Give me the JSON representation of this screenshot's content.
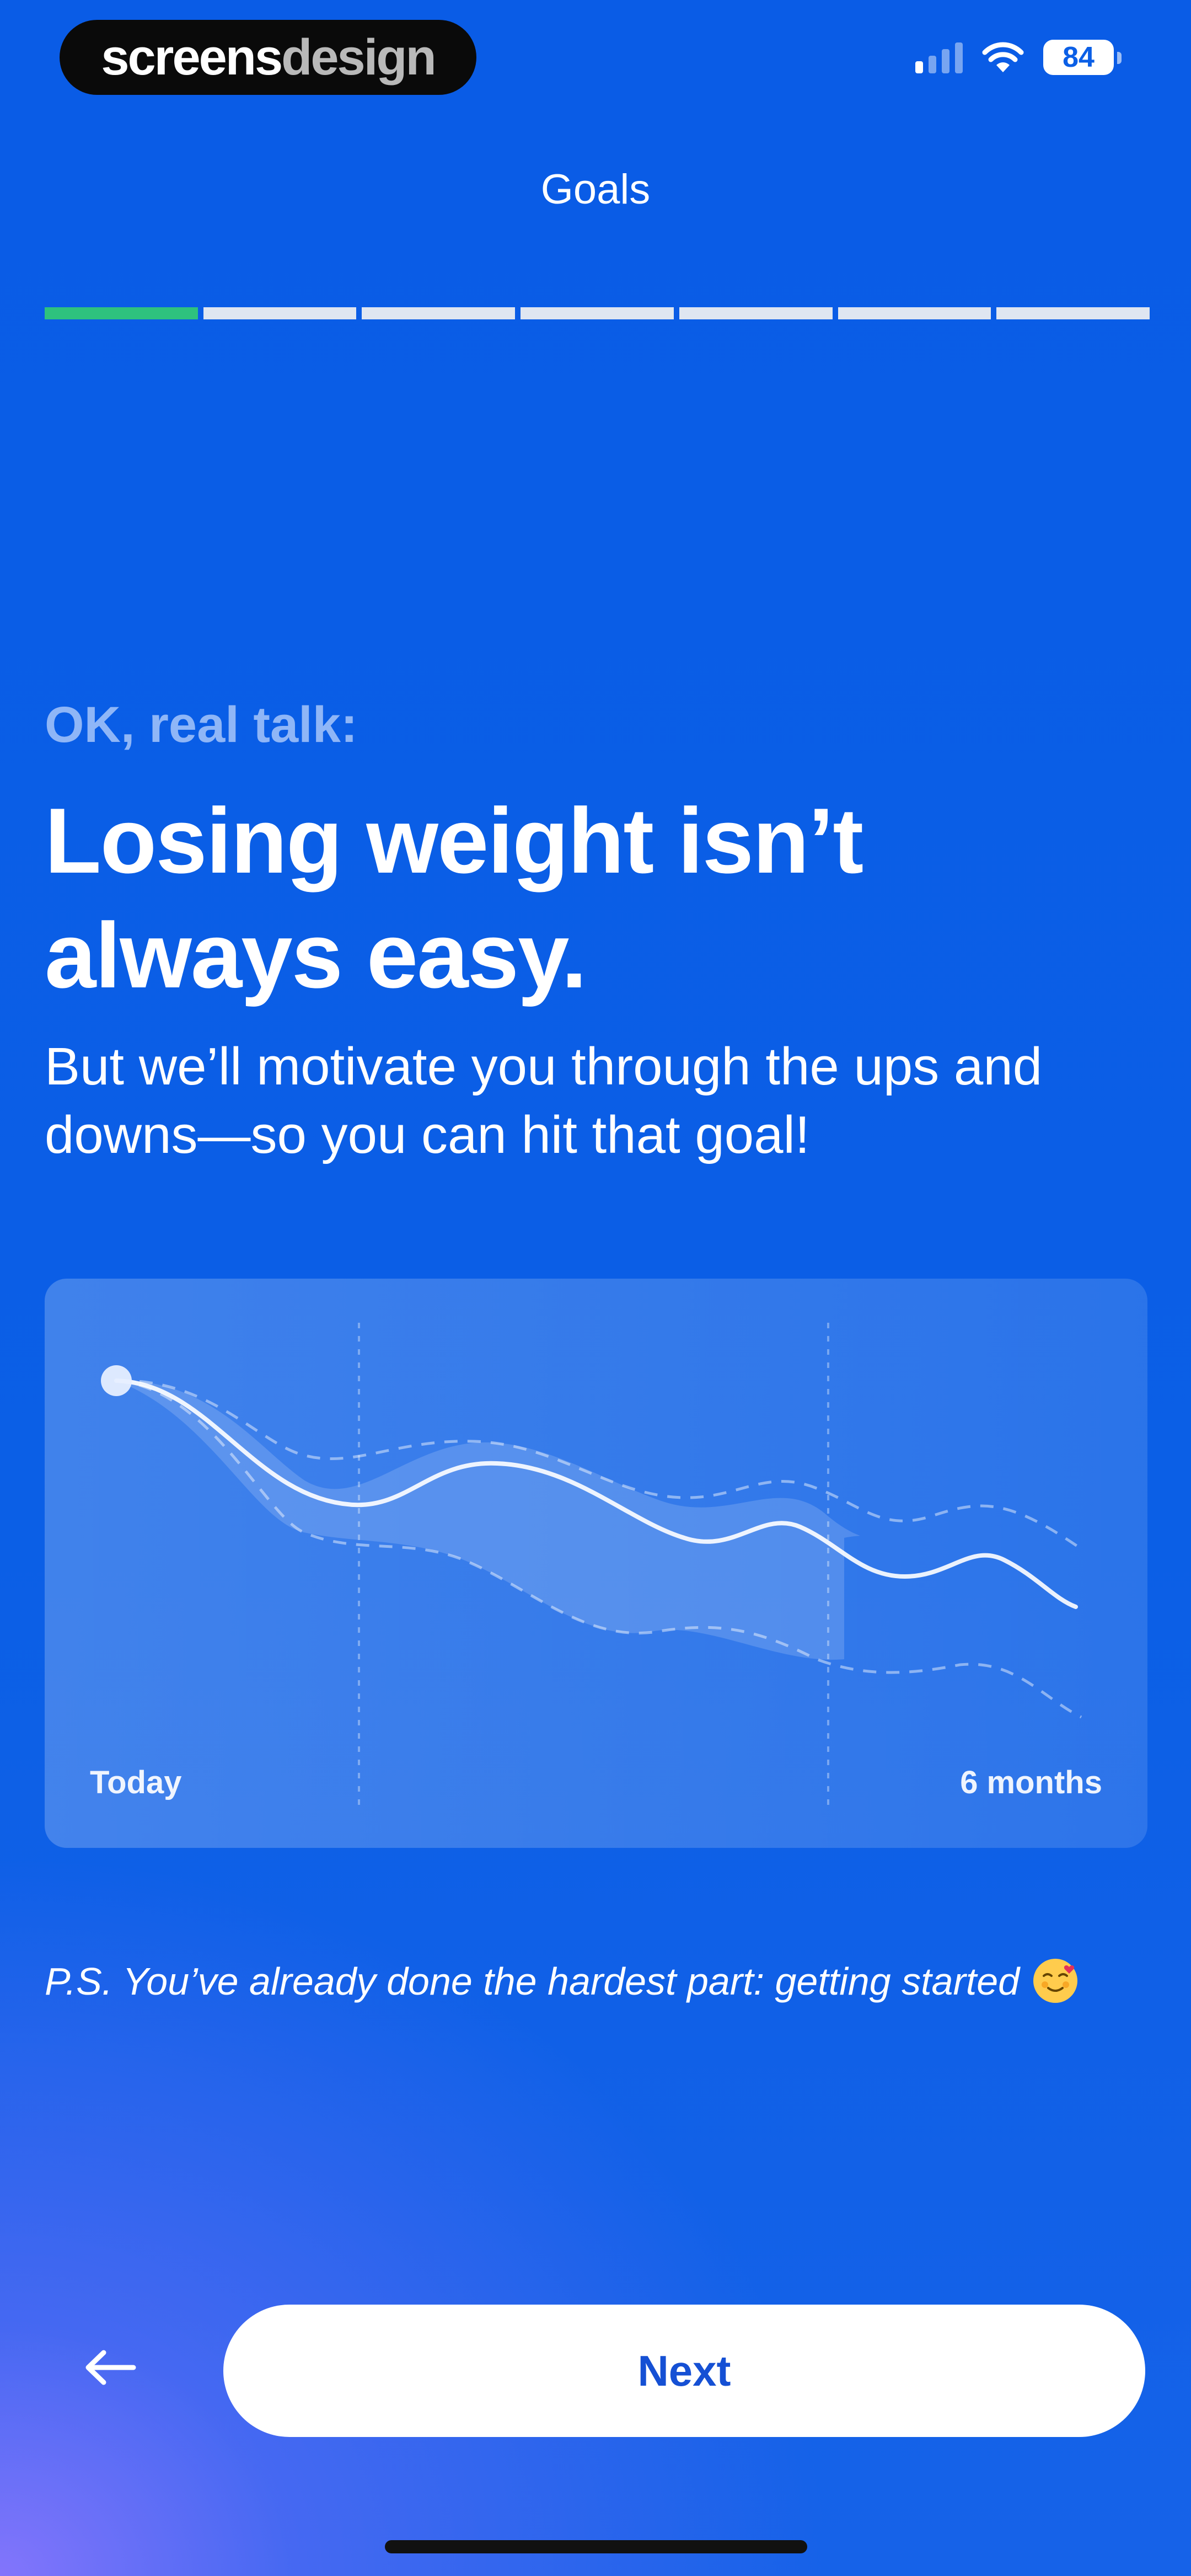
{
  "watermark": {
    "part1": "screens",
    "part2": "design"
  },
  "status_bar": {
    "battery": "84",
    "signal_icon": "cellular-signal-icon",
    "wifi_icon": "wifi-icon",
    "signal_bars_on": 1,
    "signal_bars_total": 4
  },
  "header": {
    "title": "Goals"
  },
  "progress": {
    "total_steps": 7,
    "current_step": 1,
    "active_color": "#2ec27e"
  },
  "content": {
    "eyebrow": "OK, real talk:",
    "headline": "Losing weight isn’t always easy.",
    "subtext": "But we’ll motivate you through the ups and downs—so you can hit that goal!"
  },
  "chart": {
    "start_label": "Today",
    "end_label": "6 months"
  },
  "footnote": {
    "text": "P.S. You’ve already done the hardest part: getting started",
    "emoji_icon": "smiling-face-with-hearts-emoji-icon"
  },
  "footer": {
    "back_icon": "arrow-left-icon",
    "next_label": "Next"
  },
  "colors": {
    "background": "#0b5fe6",
    "accent_green": "#2ec27e",
    "button_text": "#1550d4"
  }
}
